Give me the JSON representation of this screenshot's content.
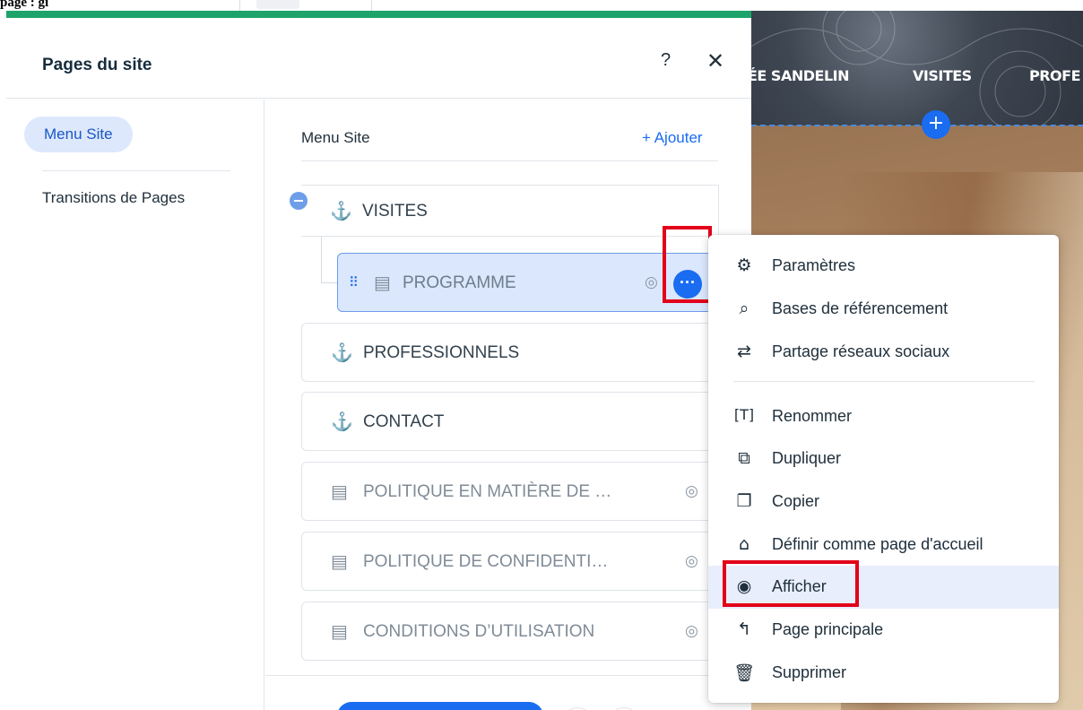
{
  "top": {
    "crumb": "page : gi"
  },
  "site": {
    "nav_items": [
      "ÉE SANDELIN",
      "VISITES",
      "PROFE"
    ],
    "add_label": "+"
  },
  "panel": {
    "title": "Pages du site",
    "help": "?",
    "close": "✕"
  },
  "left_nav": {
    "items": [
      {
        "label": "Menu Site",
        "active": true
      },
      {
        "label": "Transitions de Pages",
        "active": false
      }
    ]
  },
  "content": {
    "title": "Menu Site",
    "add_label": "+ Ajouter",
    "pages": [
      {
        "label": "VISITES",
        "type": "anchor",
        "hidden": false,
        "level": 0
      },
      {
        "label": "PROGRAMME",
        "type": "page",
        "hidden": true,
        "level": 1,
        "selected": true
      },
      {
        "label": "PROFESSIONNELS",
        "type": "anchor",
        "hidden": false,
        "level": 0
      },
      {
        "label": "CONTACT",
        "type": "anchor",
        "hidden": false,
        "level": 0
      },
      {
        "label": "POLITIQUE EN MATIÈRE DE …",
        "type": "page",
        "hidden": true,
        "level": 0
      },
      {
        "label": "POLITIQUE DE CONFIDENTI…",
        "type": "page",
        "hidden": true,
        "level": 0
      },
      {
        "label": "CONDITIONS D’UTILISATION",
        "type": "page",
        "hidden": true,
        "level": 0
      }
    ],
    "more_label": "···"
  },
  "context_menu": {
    "items": [
      {
        "label": "Paramètres",
        "icon": "gear-icon"
      },
      {
        "label": "Bases de référencement",
        "icon": "seo-icon"
      },
      {
        "label": "Partage réseaux sociaux",
        "icon": "share-icon"
      },
      {
        "label": "Renommer",
        "icon": "rename-icon"
      },
      {
        "label": "Dupliquer",
        "icon": "duplicate-icon"
      },
      {
        "label": "Copier",
        "icon": "copy-icon"
      },
      {
        "label": "Définir comme page d'accueil",
        "icon": "home-icon"
      },
      {
        "label": "Afficher",
        "icon": "eye-icon",
        "active": true
      },
      {
        "label": "Page principale",
        "icon": "main-page-icon"
      },
      {
        "label": "Supprimer",
        "icon": "trash-icon"
      }
    ]
  },
  "colors": {
    "accent": "#1a6cf1",
    "green_bar": "#1ea36a",
    "highlight_red": "#e2001a",
    "selected_bg": "#dbe7fd"
  }
}
